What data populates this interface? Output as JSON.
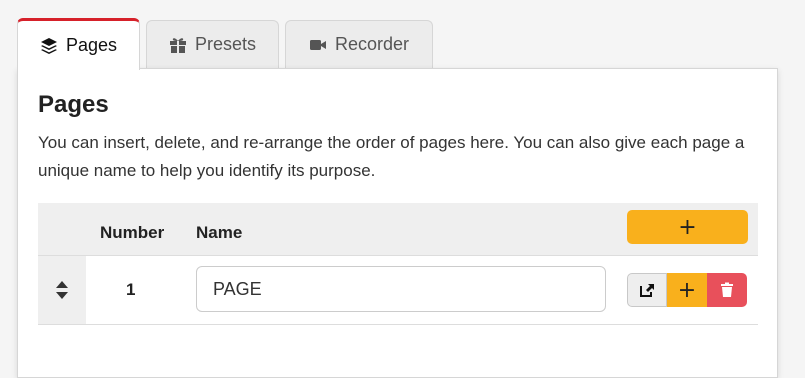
{
  "tabs": [
    {
      "label": "Pages",
      "icon": "layers-icon",
      "active": true
    },
    {
      "label": "Presets",
      "icon": "gift-icon",
      "active": false
    },
    {
      "label": "Recorder",
      "icon": "video-camera-icon",
      "active": false
    }
  ],
  "panel": {
    "title": "Pages",
    "description": "You can insert, delete, and re-arrange the order of pages here. You can also give each page a unique name to help you identify its purpose."
  },
  "table": {
    "headers": {
      "number": "Number",
      "name": "Name"
    },
    "add_button": "+",
    "rows": [
      {
        "number": "1",
        "name": "PAGE",
        "insert_label": "+"
      }
    ]
  },
  "colors": {
    "active_tab_accent": "#d6212a",
    "add_button": "#f9b01c",
    "delete_button": "#e8505b"
  }
}
